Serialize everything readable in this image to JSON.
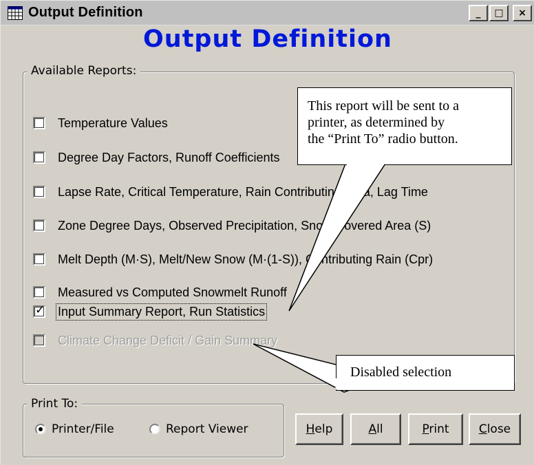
{
  "window": {
    "title": "Output Definition",
    "minimize_glyph": "_",
    "maximize_glyph": "□",
    "close_glyph": "×",
    "heading": "Output Definition",
    "heading_color": "#0018d8"
  },
  "reports": {
    "legend": "Available Reports:",
    "items": [
      {
        "label": "Temperature Values",
        "checked": false,
        "enabled": true
      },
      {
        "label": "Degree Day Factors, Runoff Coefficients",
        "checked": false,
        "enabled": true
      },
      {
        "label": "Lapse Rate, Critical Temperature, Rain Contributing Area, Lag Time",
        "checked": false,
        "enabled": true
      },
      {
        "label": "Zone Degree Days, Observed Precipitation, Snow Covered Area (S)",
        "checked": false,
        "enabled": true
      },
      {
        "label": "Melt Depth (M·S), Melt/New Snow (M·(1-S)), Contributing Rain (Cpr)",
        "checked": false,
        "enabled": true
      },
      {
        "label": "Measured vs Computed Snowmelt Runoff",
        "checked": false,
        "enabled": true
      },
      {
        "label": "Input Summary Report, Run Statistics",
        "checked": true,
        "enabled": true
      },
      {
        "label": "Climate Change Deficit / Gain Summary",
        "checked": false,
        "enabled": false
      }
    ],
    "check_glyph": "✓"
  },
  "print_to": {
    "legend": "Print To:",
    "options": [
      {
        "label": "Printer/File",
        "selected": true
      },
      {
        "label": "Report Viewer",
        "selected": false
      }
    ]
  },
  "buttons": {
    "help": {
      "accel": "H",
      "rest": "elp"
    },
    "all": {
      "accel": "A",
      "rest": "ll"
    },
    "print": {
      "accel": "P",
      "rest": "rint"
    },
    "close": {
      "accel": "C",
      "rest": "lose"
    }
  },
  "callouts": {
    "report_note": [
      "This report will be sent to a",
      "printer, as determined by",
      "the “Print To” radio button."
    ],
    "disabled_note": "Disabled selection"
  }
}
